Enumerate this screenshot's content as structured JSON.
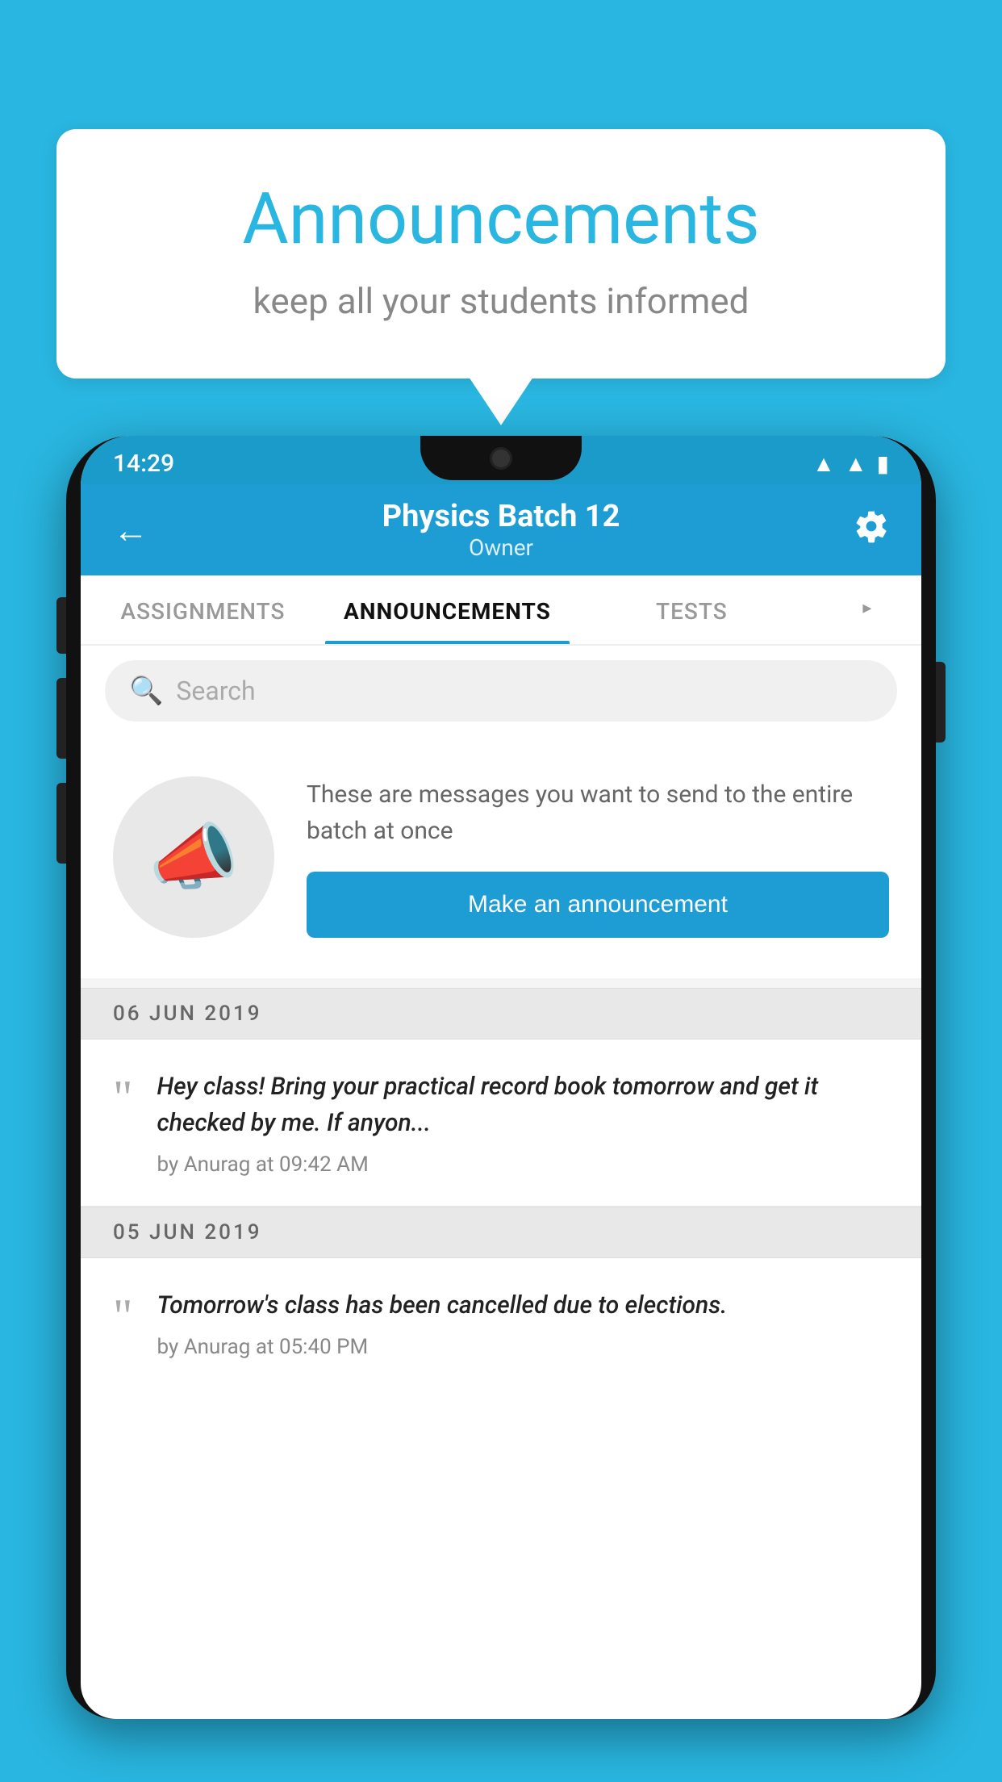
{
  "background_color": "#29B6E0",
  "speech_bubble": {
    "title": "Announcements",
    "subtitle": "keep all your students informed"
  },
  "status_bar": {
    "time": "14:29",
    "icons": [
      "wifi",
      "signal",
      "battery"
    ]
  },
  "header": {
    "back_label": "←",
    "title": "Physics Batch 12",
    "subtitle": "Owner",
    "settings_label": "⚙"
  },
  "tabs": [
    {
      "label": "ASSIGNMENTS",
      "active": false
    },
    {
      "label": "ANNOUNCEMENTS",
      "active": true
    },
    {
      "label": "TESTS",
      "active": false
    },
    {
      "label": "•••",
      "active": false
    }
  ],
  "search": {
    "placeholder": "Search"
  },
  "promo": {
    "description": "These are messages you want to send to the entire batch at once",
    "button_label": "Make an announcement"
  },
  "announcements": [
    {
      "date": "06  JUN  2019",
      "text": "Hey class! Bring your practical record book tomorrow and get it checked by me. If anyon...",
      "meta": "by Anurag at 09:42 AM"
    },
    {
      "date": "05  JUN  2019",
      "text": "Tomorrow's class has been cancelled due to elections.",
      "meta": "by Anurag at 05:40 PM"
    }
  ]
}
